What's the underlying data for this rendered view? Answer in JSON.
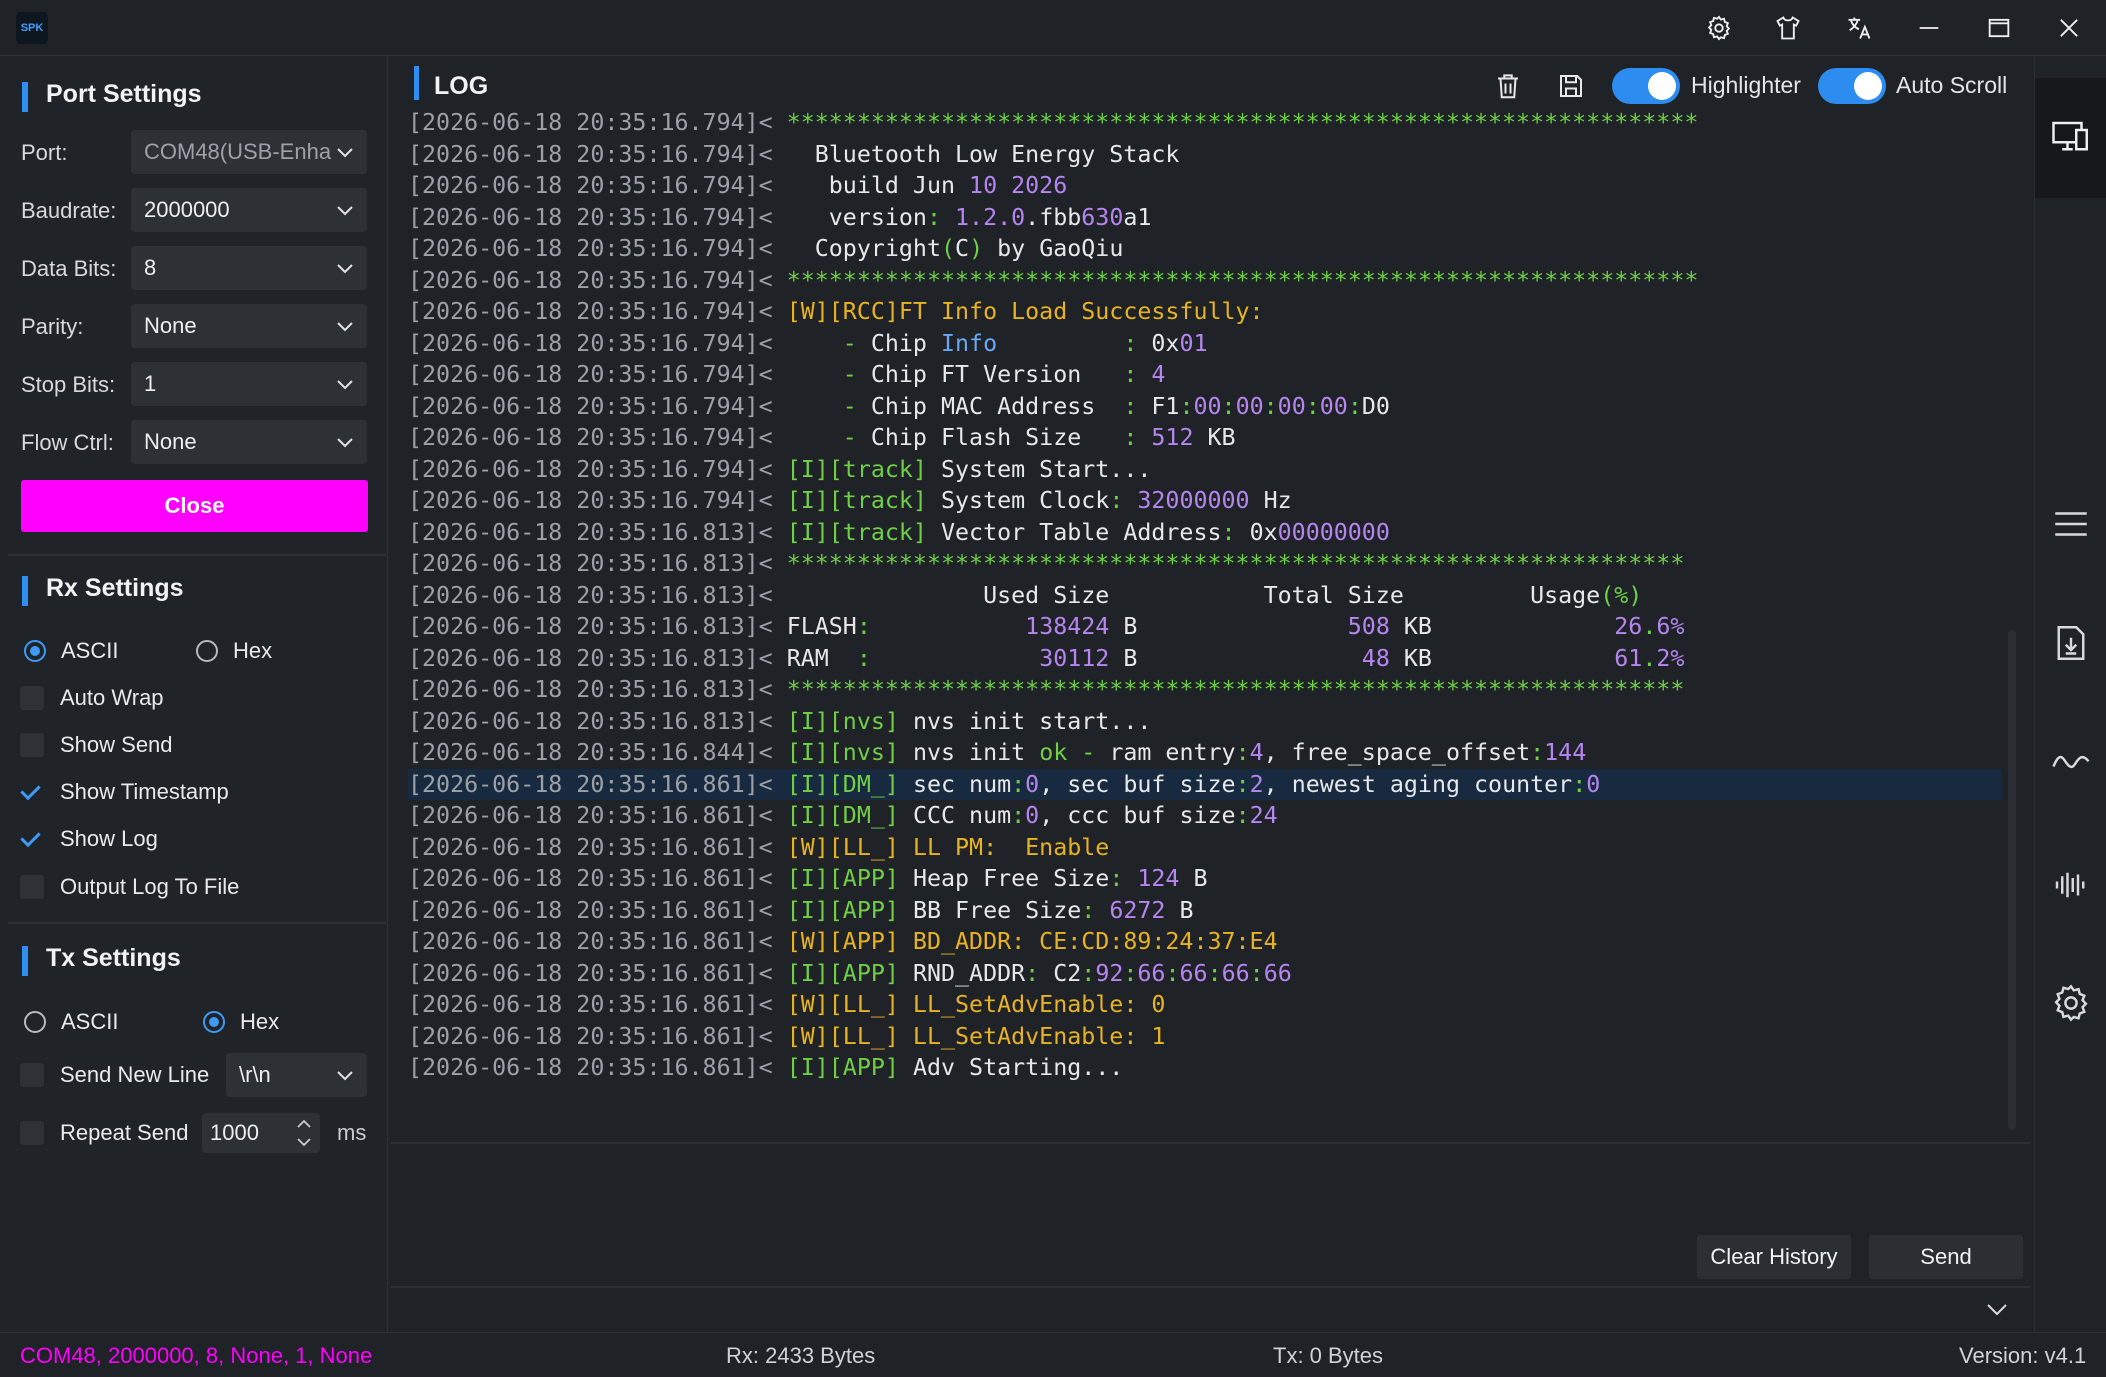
{
  "app": {
    "logo_text": "SPK"
  },
  "titlebar": {
    "icons": [
      "gear-icon",
      "shirt-icon",
      "translate-icon",
      "minimize-icon",
      "maximize-icon",
      "close-icon"
    ]
  },
  "port_settings": {
    "title": "Port Settings",
    "port": {
      "label": "Port:",
      "value": "COM48(USB-Enha"
    },
    "baudrate": {
      "label": "Baudrate:",
      "value": "2000000"
    },
    "data_bits": {
      "label": "Data Bits:",
      "value": "8"
    },
    "parity": {
      "label": "Parity:",
      "value": "None"
    },
    "stop_bits": {
      "label": "Stop Bits:",
      "value": "1"
    },
    "flow_ctrl": {
      "label": "Flow Ctrl:",
      "value": "None"
    },
    "close_button": "Close",
    "close_color": "#ff00ff"
  },
  "rx_settings": {
    "title": "Rx Settings",
    "ascii": "ASCII",
    "hex": "Hex",
    "selected": "ASCII",
    "checkboxes": [
      {
        "label": "Auto Wrap",
        "checked": false
      },
      {
        "label": "Show Send",
        "checked": false
      },
      {
        "label": "Show Timestamp",
        "checked": true
      },
      {
        "label": "Show Log",
        "checked": true
      },
      {
        "label": "Output Log To File",
        "checked": false
      }
    ]
  },
  "tx_settings": {
    "title": "Tx Settings",
    "ascii": "ASCII",
    "hex": "Hex",
    "selected": "Hex",
    "send_new_line": {
      "label": "Send New Line",
      "checked": false,
      "value": "\\r\\n"
    },
    "repeat_send": {
      "label": "Repeat Send",
      "checked": false,
      "value": "1000",
      "unit": "ms"
    }
  },
  "log": {
    "title": "LOG",
    "highlighter_label": "Highlighter",
    "highlighter_on": true,
    "autoscroll_label": "Auto Scroll",
    "autoscroll_on": true,
    "highlighted_line": 21,
    "lines": [
      [
        [
          "ts",
          "[2026-06-18 20:35:16.794]< "
        ],
        [
          "g",
          "*****************************************************************"
        ]
      ],
      [
        [
          "ts",
          "[2026-06-18 20:35:16.794]< "
        ],
        [
          "",
          "  Bluetooth Low Energy Stack"
        ]
      ],
      [
        [
          "ts",
          "[2026-06-18 20:35:16.794]< "
        ],
        [
          "",
          "   build Jun "
        ],
        [
          "p",
          "10 2026"
        ]
      ],
      [
        [
          "ts",
          "[2026-06-18 20:35:16.794]< "
        ],
        [
          "",
          "   version"
        ],
        [
          "g",
          ": "
        ],
        [
          "p",
          "1.2.0"
        ],
        [
          "",
          ".fbb"
        ],
        [
          "p",
          "630"
        ],
        [
          "",
          "a1"
        ]
      ],
      [
        [
          "ts",
          "[2026-06-18 20:35:16.794]< "
        ],
        [
          "",
          "  Copyright"
        ],
        [
          "g",
          "("
        ],
        [
          "",
          "C"
        ],
        [
          "g",
          ")"
        ],
        [
          "",
          " by GaoQiu"
        ]
      ],
      [
        [
          "ts",
          "[2026-06-18 20:35:16.794]< "
        ],
        [
          "g",
          "*****************************************************************"
        ]
      ],
      [
        [
          "ts",
          "[2026-06-18 20:35:16.794]< "
        ],
        [
          "y",
          "[W][RCC]FT Info Load Successfully:"
        ]
      ],
      [
        [
          "ts",
          "[2026-06-18 20:35:16.794]< "
        ],
        [
          "g",
          "    - "
        ],
        [
          "",
          "Chip "
        ],
        [
          "b",
          "Info"
        ],
        [
          "",
          "         "
        ],
        [
          "g",
          ": "
        ],
        [
          "",
          "0x"
        ],
        [
          "p",
          "01"
        ]
      ],
      [
        [
          "ts",
          "[2026-06-18 20:35:16.794]< "
        ],
        [
          "g",
          "    - "
        ],
        [
          "",
          "Chip FT Version   "
        ],
        [
          "g",
          ": "
        ],
        [
          "p",
          "4"
        ]
      ],
      [
        [
          "ts",
          "[2026-06-18 20:35:16.794]< "
        ],
        [
          "g",
          "    - "
        ],
        [
          "",
          "Chip MAC Address  "
        ],
        [
          "g",
          ": "
        ],
        [
          "",
          "F1"
        ],
        [
          "g",
          ":"
        ],
        [
          "p",
          "00"
        ],
        [
          "g",
          ":"
        ],
        [
          "p",
          "00"
        ],
        [
          "g",
          ":"
        ],
        [
          "p",
          "00"
        ],
        [
          "g",
          ":"
        ],
        [
          "p",
          "00"
        ],
        [
          "g",
          ":"
        ],
        [
          "",
          "D0"
        ]
      ],
      [
        [
          "ts",
          "[2026-06-18 20:35:16.794]< "
        ],
        [
          "g",
          "    - "
        ],
        [
          "",
          "Chip Flash Size   "
        ],
        [
          "g",
          ": "
        ],
        [
          "p",
          "512"
        ],
        [
          "",
          " KB"
        ]
      ],
      [
        [
          "ts",
          "[2026-06-18 20:35:16.794]< "
        ],
        [
          "g",
          "[I][track]"
        ],
        [
          "",
          " System Start..."
        ]
      ],
      [
        [
          "ts",
          "[2026-06-18 20:35:16.794]< "
        ],
        [
          "g",
          "[I][track]"
        ],
        [
          "",
          " System Clock"
        ],
        [
          "g",
          ": "
        ],
        [
          "p",
          "32000000"
        ],
        [
          "",
          " Hz"
        ]
      ],
      [
        [
          "ts",
          "[2026-06-18 20:35:16.813]< "
        ],
        [
          "g",
          "[I][track]"
        ],
        [
          "",
          " Vector Table Address"
        ],
        [
          "g",
          ": "
        ],
        [
          "",
          "0x"
        ],
        [
          "p",
          "00000000"
        ]
      ],
      [
        [
          "ts",
          "[2026-06-18 20:35:16.813]< "
        ],
        [
          "g",
          "****************************************************************"
        ]
      ],
      [
        [
          "ts",
          "[2026-06-18 20:35:16.813]< "
        ],
        [
          "",
          "              Used Size           Total Size         Usage"
        ],
        [
          "g",
          "(%)"
        ]
      ],
      [
        [
          "ts",
          "[2026-06-18 20:35:16.813]< "
        ],
        [
          "",
          "FLASH"
        ],
        [
          "g",
          ":"
        ],
        [
          "",
          "           "
        ],
        [
          "p",
          "138424"
        ],
        [
          "",
          " B               "
        ],
        [
          "p",
          "508"
        ],
        [
          "",
          " KB             "
        ],
        [
          "p",
          "26"
        ],
        [
          "g",
          "."
        ],
        [
          "p",
          "6%"
        ]
      ],
      [
        [
          "ts",
          "[2026-06-18 20:35:16.813]< "
        ],
        [
          "",
          "RAM  "
        ],
        [
          "g",
          ":"
        ],
        [
          "",
          "            "
        ],
        [
          "p",
          "30112"
        ],
        [
          "",
          " B                "
        ],
        [
          "p",
          "48"
        ],
        [
          "",
          " KB             "
        ],
        [
          "p",
          "61"
        ],
        [
          "g",
          "."
        ],
        [
          "p",
          "2%"
        ]
      ],
      [
        [
          "ts",
          "[2026-06-18 20:35:16.813]< "
        ],
        [
          "g",
          "****************************************************************"
        ]
      ],
      [
        [
          "ts",
          "[2026-06-18 20:35:16.813]< "
        ],
        [
          "g",
          "[I][nvs]"
        ],
        [
          "",
          " nvs init start..."
        ]
      ],
      [
        [
          "ts",
          "[2026-06-18 20:35:16.844]< "
        ],
        [
          "g",
          "[I][nvs]"
        ],
        [
          "",
          " nvs init "
        ],
        [
          "g",
          "ok"
        ],
        [
          "g",
          " - "
        ],
        [
          "",
          "ram entry"
        ],
        [
          "g",
          ":"
        ],
        [
          "p",
          "4"
        ],
        [
          "",
          ", free_space_offset"
        ],
        [
          "g",
          ":"
        ],
        [
          "p",
          "144"
        ]
      ],
      [
        [
          "ts",
          "[2026-06-18 20:35:16.861]< "
        ],
        [
          "g",
          "[I][DM_]"
        ],
        [
          "",
          " sec num"
        ],
        [
          "g",
          ":"
        ],
        [
          "p",
          "0"
        ],
        [
          "",
          ", sec buf size"
        ],
        [
          "g",
          ":"
        ],
        [
          "p",
          "2"
        ],
        [
          "",
          ", newest aging counter"
        ],
        [
          "g",
          ":"
        ],
        [
          "p",
          "0"
        ]
      ],
      [
        [
          "ts",
          "[2026-06-18 20:35:16.861]< "
        ],
        [
          "g",
          "[I][DM_]"
        ],
        [
          "",
          " CCC num"
        ],
        [
          "g",
          ":"
        ],
        [
          "p",
          "0"
        ],
        [
          "",
          ", ccc buf size"
        ],
        [
          "g",
          ":"
        ],
        [
          "p",
          "24"
        ]
      ],
      [
        [
          "ts",
          "[2026-06-18 20:35:16.861]< "
        ],
        [
          "y",
          "[W][LL_] LL PM:  Enable"
        ]
      ],
      [
        [
          "ts",
          "[2026-06-18 20:35:16.861]< "
        ],
        [
          "g",
          "[I][APP]"
        ],
        [
          "",
          " Heap Free Size"
        ],
        [
          "g",
          ": "
        ],
        [
          "p",
          "124"
        ],
        [
          "",
          " B"
        ]
      ],
      [
        [
          "ts",
          "[2026-06-18 20:35:16.861]< "
        ],
        [
          "g",
          "[I][APP]"
        ],
        [
          "",
          " BB Free Size"
        ],
        [
          "g",
          ": "
        ],
        [
          "p",
          "6272"
        ],
        [
          "",
          " B"
        ]
      ],
      [
        [
          "ts",
          "[2026-06-18 20:35:16.861]< "
        ],
        [
          "y",
          "[W][APP] BD_ADDR: CE:CD:89:24:37:E4"
        ]
      ],
      [
        [
          "ts",
          "[2026-06-18 20:35:16.861]< "
        ],
        [
          "g",
          "[I][APP]"
        ],
        [
          "",
          " RND_ADDR"
        ],
        [
          "g",
          ": "
        ],
        [
          "",
          "C2"
        ],
        [
          "g",
          ":"
        ],
        [
          "p",
          "92"
        ],
        [
          "g",
          ":"
        ],
        [
          "p",
          "66"
        ],
        [
          "g",
          ":"
        ],
        [
          "p",
          "66"
        ],
        [
          "g",
          ":"
        ],
        [
          "p",
          "66"
        ],
        [
          "g",
          ":"
        ],
        [
          "p",
          "66"
        ]
      ],
      [
        [
          "ts",
          "[2026-06-18 20:35:16.861]< "
        ],
        [
          "y",
          "[W][LL_] LL_SetAdvEnable: 0"
        ]
      ],
      [
        [
          "ts",
          "[2026-06-18 20:35:16.861]< "
        ],
        [
          "y",
          "[W][LL_] LL_SetAdvEnable: 1"
        ]
      ],
      [
        [
          "ts",
          "[2026-06-18 20:35:16.861]< "
        ],
        [
          "g",
          "[I][APP]"
        ],
        [
          "",
          " Adv Starting..."
        ]
      ]
    ]
  },
  "tx": {
    "clear_history": "Clear History",
    "send": "Send"
  },
  "rightbar": {
    "icons": [
      "devices-icon",
      "menu-icon",
      "file-download-icon",
      "wave-icon",
      "waveform-icon",
      "settings-icon"
    ]
  },
  "status": {
    "port_info": "COM48, 2000000, 8, None, 1, None",
    "port_info_color": "#ff00ff",
    "rx": "Rx: 2433 Bytes",
    "tx": "Tx: 0 Bytes",
    "version": "Version: v4.1"
  }
}
